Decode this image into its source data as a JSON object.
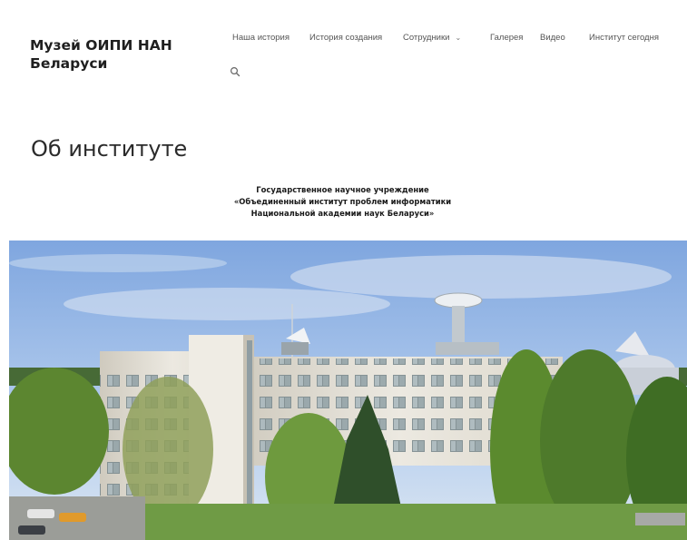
{
  "site": {
    "title": "Музей ОИПИ НАН Беларуси"
  },
  "nav": {
    "items": [
      {
        "label": "Наша история"
      },
      {
        "label": "История создания"
      },
      {
        "label": "Сотрудники",
        "has_dropdown": true,
        "icon": "chevron-down-icon"
      },
      {
        "label": "Галерея"
      },
      {
        "label": "Видео"
      },
      {
        "label": "Институт сегодня"
      }
    ],
    "search_icon": "search-icon"
  },
  "page": {
    "title": "Об институте",
    "subheading": {
      "line1": "Государственное научное учреждение",
      "line2": "«Объединенный институт проблем информатики",
      "line3": "Национальной академии наук Беларуси»"
    }
  },
  "colors": {
    "sky": "#9bbde6",
    "building": "#e9e6dd",
    "foliage": "#4e7a2b",
    "text": "#222222"
  }
}
